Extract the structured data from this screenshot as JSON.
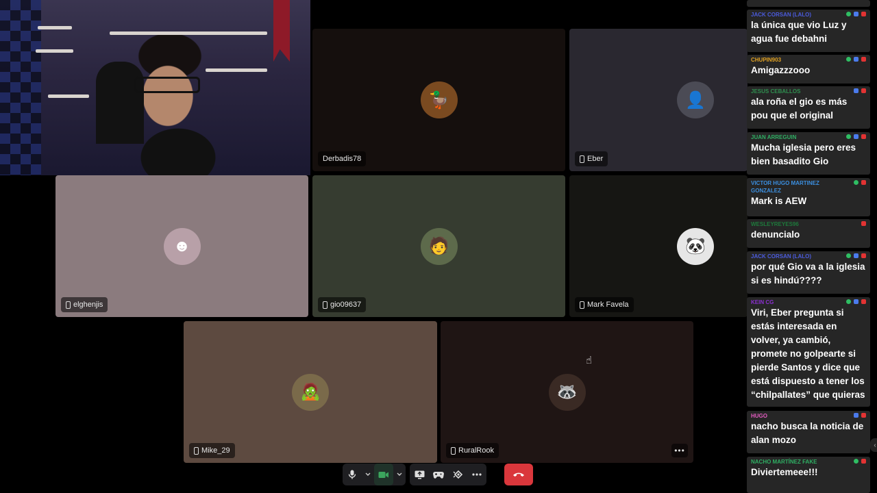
{
  "participants": [
    {
      "name": "Derbadis78",
      "bg": "#150f0d",
      "avatar_bg": "#7a4a20",
      "avatar": "🦆",
      "phone": false
    },
    {
      "name": "Eber",
      "bg": "#2a2830",
      "avatar_bg": "#4b4b55",
      "avatar": "👤",
      "phone": true
    },
    {
      "name": "elghenjis",
      "bg": "#8b7b7e",
      "avatar_bg": "#b8a0a8",
      "avatar": "☻",
      "phone": true
    },
    {
      "name": "gio09637",
      "bg": "#363c30",
      "avatar_bg": "#5d6a4b",
      "avatar": "🧑",
      "phone": true
    },
    {
      "name": "Mark Favela",
      "bg": "#161613",
      "avatar_bg": "#e6e6e6",
      "avatar": "🐼",
      "phone": true
    },
    {
      "name": "Mike_29",
      "bg": "#5d4a40",
      "avatar_bg": "#7a6a4a",
      "avatar": "🧟",
      "phone": true
    },
    {
      "name": "RuralRook",
      "bg": "#1f1514",
      "avatar_bg": "#3a2a24",
      "avatar": "🦝",
      "phone": true
    }
  ],
  "chat": [
    {
      "user": "JACK CORSAN (LALO)",
      "user_color": "#4b5bdc",
      "text": "la única que vio Luz y agua fue debahni",
      "badges": [
        "green",
        "blue",
        "red"
      ]
    },
    {
      "user": "CHUPIN903",
      "user_color": "#e3a322",
      "text": "Amigazzzooo",
      "badges": [
        "green",
        "blue",
        "red"
      ]
    },
    {
      "user": "JESUS CEBALLOS",
      "user_color": "#2f8f4f",
      "text": "ala roña el gio es más pou que el original",
      "badges": [
        "blue",
        "red"
      ]
    },
    {
      "user": "JUAN ARREGUIN",
      "user_color": "#2fae63",
      "text": "Mucha iglesia pero eres bien basadito Gio",
      "badges": [
        "green",
        "blue",
        "red"
      ]
    },
    {
      "user": "VICTOR HUGO MARTINEZ GONZALEZ",
      "user_color": "#3b8fe0",
      "text": "Mark is AEW",
      "badges": [
        "green",
        "red"
      ]
    },
    {
      "user": "WESLEYREYES96",
      "user_color": "#1e7a3c",
      "text": "denuncialo",
      "badges": [
        "red"
      ]
    },
    {
      "user": "JACK CORSAN (LALO)",
      "user_color": "#4b5bdc",
      "text": "por qué Gio va a la iglesia si es hindú????",
      "badges": [
        "green",
        "blue",
        "red"
      ]
    },
    {
      "user": "KEIN CG",
      "user_color": "#8a2fd0",
      "text": "Viri, Eber pregunta si estás interesada en volver, ya cambió, promete no golpearte si pierde Santos y dice que está dispuesto a tener los “chilpallates” que quieras",
      "badges": [
        "green",
        "blue",
        "red"
      ]
    },
    {
      "user": "HUGO",
      "user_color": "#e25bbf",
      "text": "nacho busca la noticia de alan mozo",
      "badges": [
        "blue",
        "red"
      ]
    },
    {
      "user": "NACHO MARTÍNEZ FAKE",
      "user_color": "#2fae63",
      "text": "Diviertemeee!!!",
      "badges": [
        "green",
        "red"
      ]
    }
  ]
}
